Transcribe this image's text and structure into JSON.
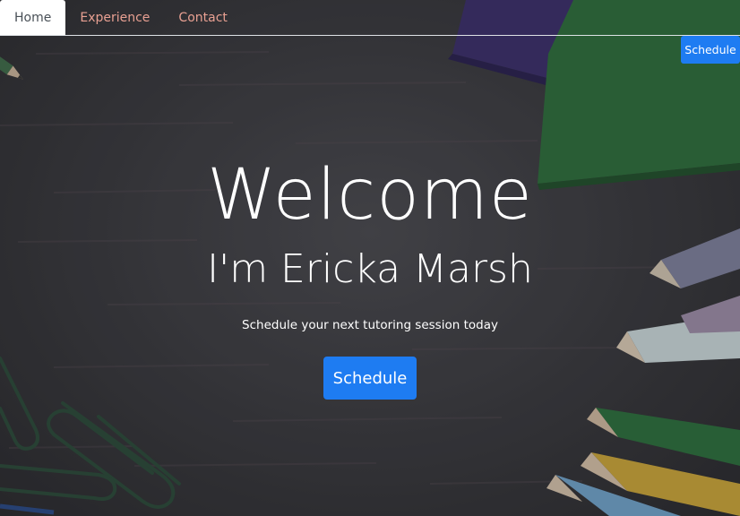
{
  "nav": {
    "items": [
      {
        "label": "Home",
        "active": true
      },
      {
        "label": "Experience",
        "active": false
      },
      {
        "label": "Contact",
        "active": false
      }
    ]
  },
  "top_button": {
    "label": "Schedule"
  },
  "hero": {
    "title": "Welcome",
    "subtitle": "I'm Ericka Marsh",
    "tagline": "Schedule your next tutoring session today",
    "cta_label": "Schedule"
  },
  "colors": {
    "accent": "#1e7cf2",
    "nav_link": "#e8a092",
    "background": "#3a3a3f"
  }
}
